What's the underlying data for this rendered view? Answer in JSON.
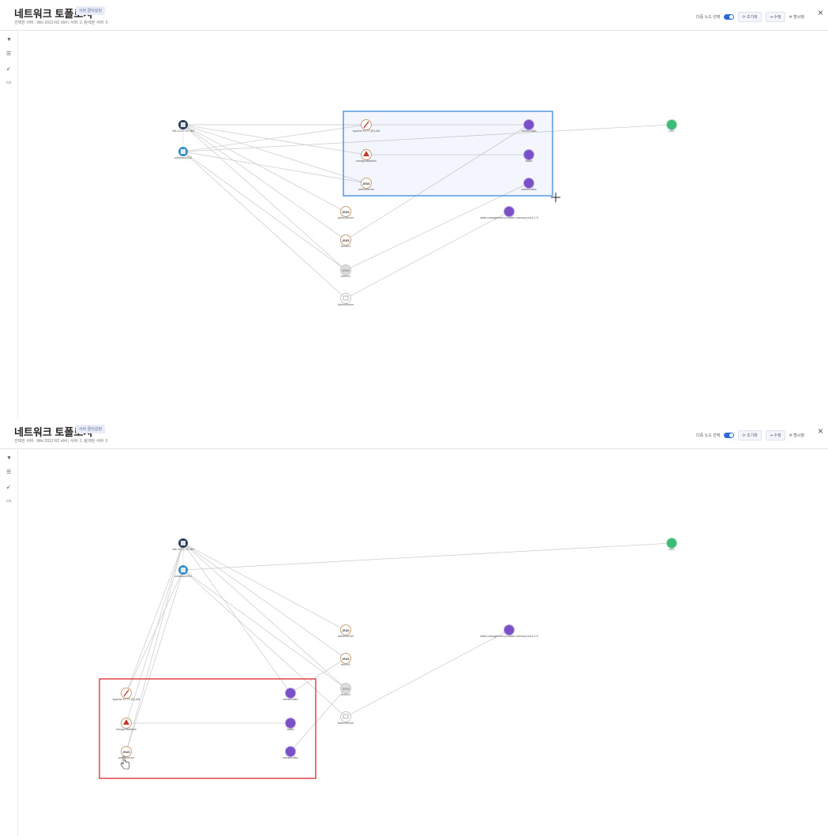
{
  "panels": [
    {
      "title": "네트워크 토폴로지",
      "badge": "서버 클릭설정",
      "subtitle": "선택한 서버 : Win 2012 R2 x64 | 서버: 2, 탐색된 서버: 5",
      "toolbar": {
        "multi_select_label": "다중 노드 선택",
        "reset": "초기화",
        "edit": "수정",
        "legend": "범시정"
      },
      "close_glyph": "×",
      "selection": {
        "color": "#2f7fd9",
        "fill": "rgba(47,127,217,0.06)"
      },
      "nodes": {
        "win2012": "Win 2012 R2 x64",
        "windows": "windows2012",
        "apache": "Apache HTTP [R] x64",
        "mongo": "mongoDBadmin",
        "admin1": "adminServer",
        "kafka1": "adminKafka",
        "kafka2": "kafka",
        "kafka3": "adminKafka",
        "jeus": "adminServer",
        "server1": "server1",
        "server2": "server1",
        "admin2": "AdminServer",
        "statemgr": "state-management-provider-memory:on12.1.5",
        "url": "URL"
      }
    },
    {
      "title": "네트워크 토폴로지",
      "badge": "서버 클릭설정",
      "subtitle": "선택한 서버 : Win 2012 R2 x64 | 서버: 2, 탐색된 서버: 5",
      "toolbar": {
        "multi_select_label": "다중 노드 선택",
        "reset": "초기화",
        "edit": "수정",
        "legend": "범시정"
      },
      "close_glyph": "×",
      "selection": {
        "color": "#e0373a",
        "fill": "rgba(0,0,0,0)"
      },
      "nodes": {
        "win2012": "Win 2012 R2 x64",
        "windows": "windows2012",
        "apache": "Apache HTTP [R] x64",
        "mongo": "mongoDBadmin",
        "admin1": "adminServer",
        "kafka1": "adminKafka",
        "kafka2": "kafka",
        "kafka3": "adminKafka",
        "jeus": "adminServer",
        "server1": "server1",
        "server2": "server1",
        "admin2": "AdminServer",
        "statemgr": "state-management-provider-memory:on12.1.5",
        "url": "URL"
      }
    }
  ],
  "colors": {
    "edge": "#cfcfcf",
    "windows": "#2c3e5c",
    "windows2": "#3a8dc9",
    "kafka": "#7a4fc8",
    "url": "#3dbb77",
    "apache": "#c0392b",
    "mongo": "#c0392b",
    "jeus": "#3a3a3a",
    "server_gray": "#b8b8b8"
  },
  "icons": [
    "filter-icon",
    "list-icon",
    "pointer-icon",
    "comment-icon",
    "refresh-icon",
    "edit-icon",
    "pin-icon",
    "close-icon"
  ]
}
